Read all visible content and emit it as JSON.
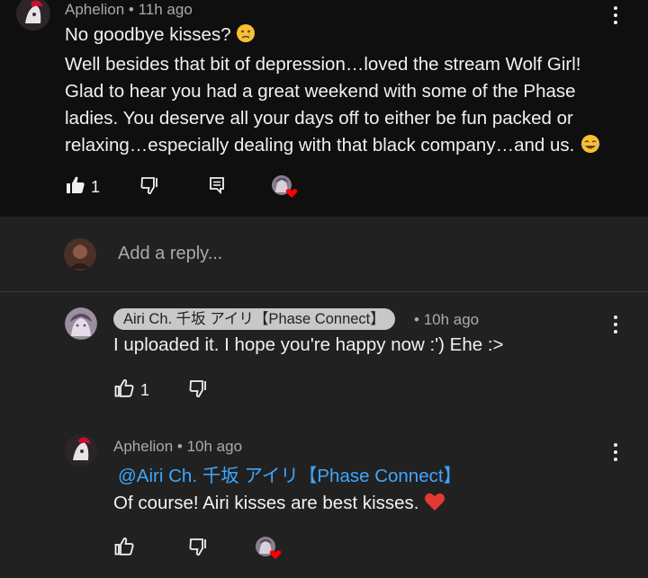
{
  "comment1": {
    "author": "Aphelion",
    "time": "11h ago",
    "line1": "No goodbye kisses?",
    "line2": "Well besides that bit of depression…loved the stream Wolf Girl!",
    "line3": "Glad to hear you had a great weekend with some of the Phase",
    "line4": "ladies. You deserve all your days off to either be fun packed or",
    "line5": "relaxing…especially dealing with that black company…and us.",
    "like_count": "1"
  },
  "reply_box": {
    "placeholder": "Add a reply..."
  },
  "reply1": {
    "author": "Airi Ch. 千坂 アイリ【Phase Connect】",
    "time": "10h ago",
    "text": "I uploaded it. I hope you're happy now :') Ehe :>",
    "like_count": "1"
  },
  "reply2": {
    "author": "Aphelion",
    "time": "10h ago",
    "mention": "@Airi Ch. 千坂 アイリ【Phase Connect】",
    "text": "Of course! Airi kisses are best kisses."
  },
  "separator": "•",
  "colors": {
    "top_bg": "#0f0f0f",
    "page_bg": "#212121",
    "mention": "#3ea6ff",
    "heart": "#ff0000"
  },
  "icons": [
    "like-icon",
    "dislike-icon",
    "reply-icon",
    "creator-heart-icon",
    "more-vert-icon"
  ]
}
